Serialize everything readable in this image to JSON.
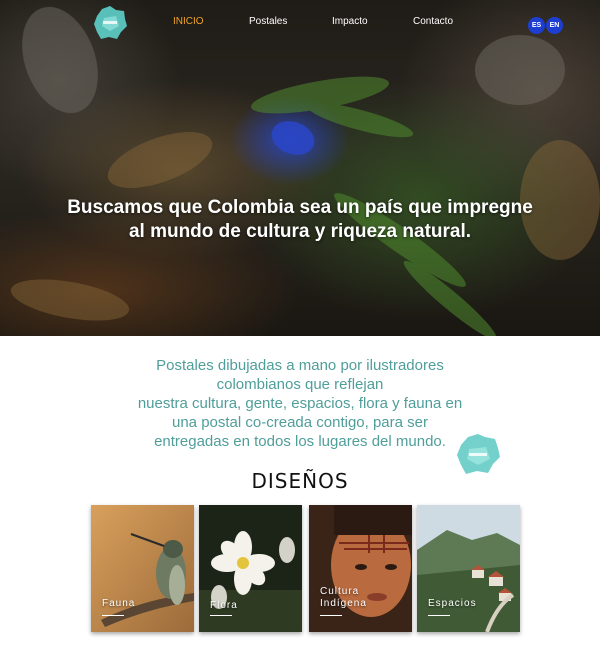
{
  "nav": {
    "items": [
      {
        "label": "INICIO",
        "active": true
      },
      {
        "label": "Postales",
        "active": false
      },
      {
        "label": "Impacto",
        "active": false
      },
      {
        "label": "Contacto",
        "active": false
      }
    ],
    "languages": [
      "ES",
      "EN"
    ],
    "accent_color": "#f0a22a",
    "lang_color": "#1d3ed1"
  },
  "logo": {
    "icon": "brand-logo-icon",
    "color": "#5cc8c2"
  },
  "hero": {
    "title_line1": "Buscamos que Colombia sea un país que impregne",
    "title_line2": "al mundo de cultura y riqueza natural."
  },
  "intro": {
    "lines": [
      "Postales dibujadas a mano por ilustradores",
      "colombianos que reflejan",
      "nuestra cultura, gente, espacios, flora y fauna en",
      "una postal co-creada contigo, para ser",
      "entregadas en todos los lugares del mundo."
    ],
    "color": "#4f9e9a"
  },
  "designs": {
    "title": "DISEÑOS",
    "cards": [
      {
        "label_line1": "Fauna",
        "label_line2": ""
      },
      {
        "label_line1": "Flora",
        "label_line2": ""
      },
      {
        "label_line1": "Cultura",
        "label_line2": "Indígena"
      },
      {
        "label_line1": "Espacios",
        "label_line2": ""
      }
    ]
  }
}
